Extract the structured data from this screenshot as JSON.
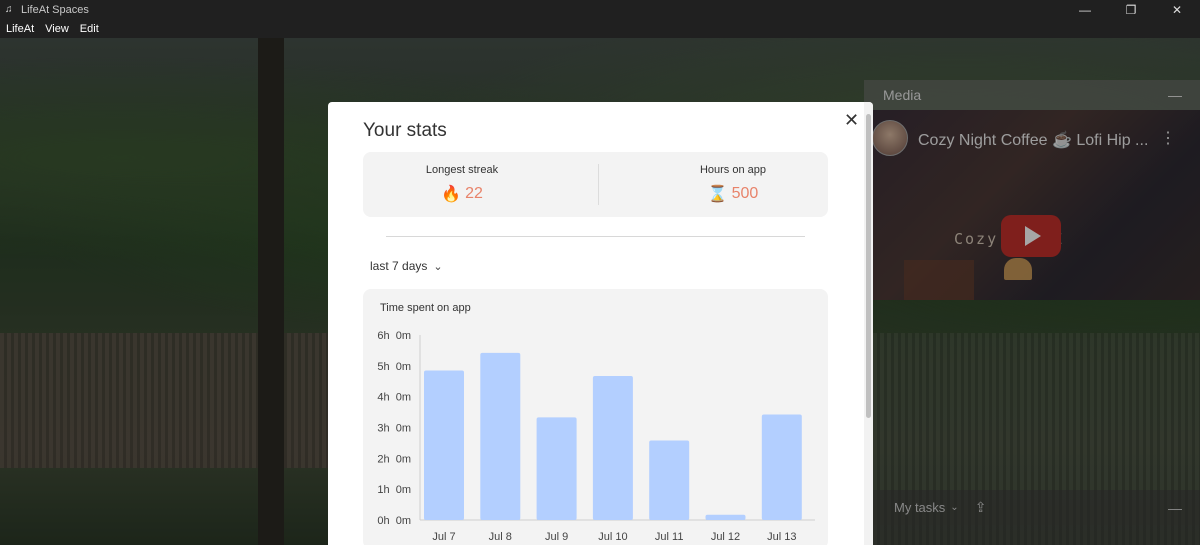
{
  "window": {
    "title": "LifeAt Spaces",
    "minimize_glyph": "—",
    "restore_glyph": "❐",
    "close_glyph": "✕"
  },
  "menu": {
    "items": [
      "LifeAt",
      "View",
      "Edit"
    ]
  },
  "media": {
    "header_label": "Media",
    "minimize_glyph": "—",
    "video_title": "Cozy Night Coffee ☕ Lofi Hip ...",
    "more_glyph": "⋮",
    "thumbnail_text": "Cozy       OFFEE"
  },
  "tasks": {
    "label": "My tasks",
    "chevron": "⌄",
    "upload_glyph": "⇪",
    "minimize_glyph": "—"
  },
  "stats": {
    "title": "Your stats",
    "close_glyph": "✕",
    "longest_streak": {
      "label": "Longest streak",
      "icon": "fire-icon",
      "icon_glyph": "🔥",
      "value": "22"
    },
    "hours_on_app": {
      "label": "Hours on app",
      "icon": "hourglass-icon",
      "icon_glyph": "⌛",
      "value": "500"
    },
    "range": {
      "label": "last 7 days",
      "chevron": "⌄"
    },
    "accent_color": "#e8836a"
  },
  "chart_data": {
    "type": "bar",
    "title": "Time spent on app",
    "categories": [
      "Jul 7",
      "Jul 8",
      "Jul 9",
      "Jul 10",
      "Jul 11",
      "Jul 12",
      "Jul 13"
    ],
    "values": [
      4.85,
      5.42,
      3.33,
      4.67,
      2.58,
      0.17,
      3.42
    ],
    "unit": "hours",
    "y_ticks": [
      "0h  0m",
      "1h  0m",
      "2h  0m",
      "3h  0m",
      "4h  0m",
      "5h  0m",
      "6h  0m"
    ],
    "ylim": [
      0,
      6
    ],
    "bar_color": "#b3cfff",
    "grid": false
  }
}
